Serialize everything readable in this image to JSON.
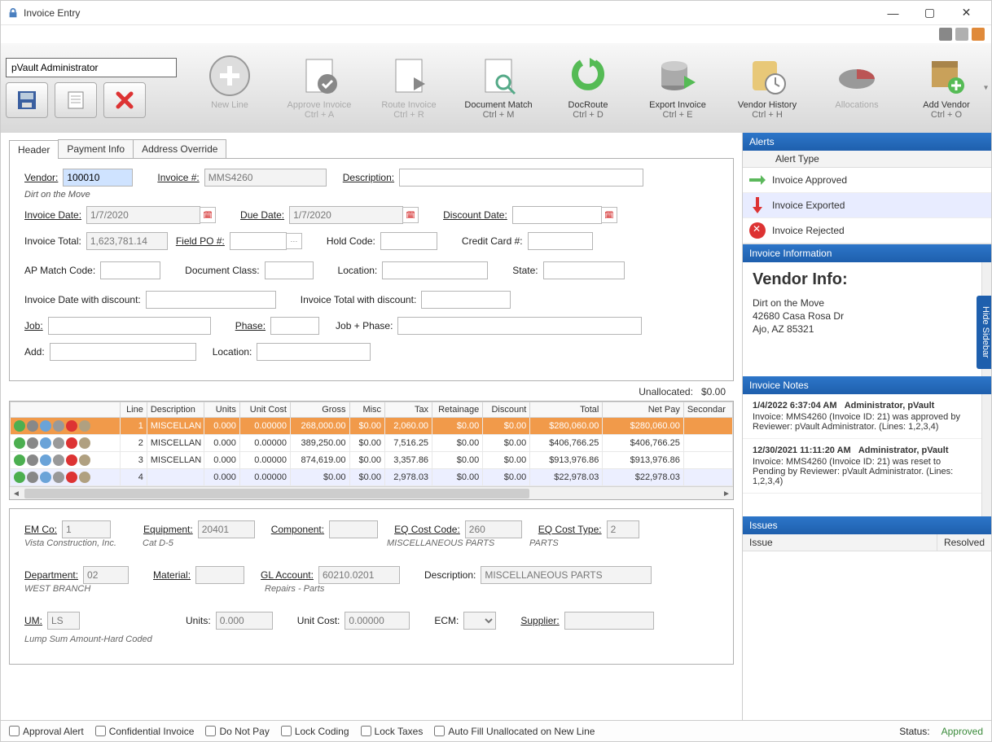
{
  "window": {
    "title": "Invoice Entry"
  },
  "user": "pVault Administrator",
  "toolbar": [
    {
      "label": "New Line",
      "shortcut": "",
      "disabled": true,
      "icon": "plus"
    },
    {
      "label": "Approve Invoice",
      "shortcut": "Ctrl + A",
      "disabled": true,
      "icon": "approve"
    },
    {
      "label": "Route Invoice",
      "shortcut": "Ctrl + R",
      "disabled": true,
      "icon": "route"
    },
    {
      "label": "Document Match",
      "shortcut": "Ctrl + M",
      "disabled": false,
      "icon": "docmatch"
    },
    {
      "label": "DocRoute",
      "shortcut": "Ctrl + D",
      "disabled": false,
      "icon": "docroute"
    },
    {
      "label": "Export Invoice",
      "shortcut": "Ctrl + E",
      "disabled": false,
      "icon": "export"
    },
    {
      "label": "Vendor History",
      "shortcut": "Ctrl + H",
      "disabled": false,
      "icon": "history"
    },
    {
      "label": "Allocations",
      "shortcut": "",
      "disabled": true,
      "icon": "alloc"
    },
    {
      "label": "Add Vendor",
      "shortcut": "Ctrl + O",
      "disabled": false,
      "icon": "addvendor"
    }
  ],
  "tabs": [
    "Header",
    "Payment Info",
    "Address Override"
  ],
  "header": {
    "vendor_label": "Vendor:",
    "vendor": "100010",
    "vendor_name": "Dirt on the Move",
    "invoice_no_label": "Invoice #:",
    "invoice_no": "MMS4260",
    "description_label": "Description:",
    "description": "",
    "invoice_date_label": "Invoice Date:",
    "invoice_date": "1/7/2020",
    "due_date_label": "Due Date:",
    "due_date": "1/7/2020",
    "discount_date_label": "Discount Date:",
    "discount_date": "",
    "invoice_total_label": "Invoice Total:",
    "invoice_total": "1,623,781.14",
    "field_po_label": "Field PO #:",
    "field_po": "",
    "hold_code_label": "Hold Code:",
    "hold_code": "",
    "credit_card_label": "Credit Card #:",
    "credit_card": "",
    "ap_match_label": "AP Match Code:",
    "ap_match": "",
    "doc_class_label": "Document Class:",
    "doc_class": "",
    "location_label": "Location:",
    "location": "",
    "state_label": "State:",
    "state": "",
    "inv_date_disc_label": "Invoice Date with discount:",
    "inv_date_disc": "",
    "inv_total_disc_label": "Invoice Total with discount:",
    "inv_total_disc": "",
    "job_label": "Job:",
    "job": "",
    "phase_label": "Phase:",
    "phase": "",
    "job_phase_label": "Job + Phase:",
    "job_phase": "",
    "add_label": "Add:",
    "add": "",
    "location2_label": "Location:",
    "location2": ""
  },
  "unallocated_label": "Unallocated:",
  "unallocated": "$0.00",
  "grid": {
    "columns": [
      "",
      "Line",
      "Description",
      "Units",
      "Unit Cost",
      "Gross",
      "Misc",
      "Tax",
      "Retainage",
      "Discount",
      "Total",
      "Net Pay",
      "Secondar"
    ],
    "rows": [
      {
        "line": "1",
        "desc": "MISCELLAN",
        "units": "0.000",
        "unitcost": "0.00000",
        "gross": "268,000.00",
        "misc": "$0.00",
        "tax": "2,060.00",
        "retainage": "$0.00",
        "discount": "$0.00",
        "total": "$280,060.00",
        "netpay": "$280,060.00",
        "sel": true
      },
      {
        "line": "2",
        "desc": "MISCELLAN",
        "units": "0.000",
        "unitcost": "0.00000",
        "gross": "389,250.00",
        "misc": "$0.00",
        "tax": "7,516.25",
        "retainage": "$0.00",
        "discount": "$0.00",
        "total": "$406,766.25",
        "netpay": "$406,766.25"
      },
      {
        "line": "3",
        "desc": "MISCELLAN",
        "units": "0.000",
        "unitcost": "0.00000",
        "gross": "874,619.00",
        "misc": "$0.00",
        "tax": "3,357.86",
        "retainage": "$0.00",
        "discount": "$0.00",
        "total": "$913,976.86",
        "netpay": "$913,976.86"
      },
      {
        "line": "4",
        "desc": "",
        "units": "0.000",
        "unitcost": "0.00000",
        "gross": "$0.00",
        "misc": "$0.00",
        "tax": "2,978.03",
        "retainage": "$0.00",
        "discount": "$0.00",
        "total": "$22,978.03",
        "netpay": "$22,978.03",
        "alt": true
      }
    ]
  },
  "detail": {
    "emco_label": "EM Co:",
    "emco": "1",
    "emco_sub": "Vista Construction, Inc.",
    "equipment_label": "Equipment:",
    "equipment": "20401",
    "equipment_sub": "Cat D-5",
    "component_label": "Component:",
    "component": "",
    "eqcostcode_label": "EQ Cost Code:",
    "eqcostcode": "260",
    "eqcostcode_sub": "MISCELLANEOUS PARTS",
    "eqcosttype_label": "EQ Cost Type:",
    "eqcosttype": "2",
    "eqcosttype_sub": "PARTS",
    "department_label": "Department:",
    "department": "02",
    "department_sub": "WEST BRANCH",
    "material_label": "Material:",
    "material": "",
    "glaccount_label": "GL Account:",
    "glaccount": "60210.0201",
    "glaccount_sub": "Repairs - Parts",
    "desc_label": "Description:",
    "desc": "MISCELLANEOUS PARTS",
    "um_label": "UM:",
    "um": "LS",
    "um_sub": "Lump Sum Amount-Hard Coded",
    "units_label": "Units:",
    "units": "0.000",
    "unitcost_label": "Unit Cost:",
    "unitcost": "0.00000",
    "ecm_label": "ECM:",
    "ecm": "",
    "supplier_label": "Supplier:",
    "supplier": ""
  },
  "alerts": {
    "title": "Alerts",
    "col": "Alert Type",
    "rows": [
      {
        "text": "Invoice Approved",
        "icon": "approve"
      },
      {
        "text": "Invoice Exported",
        "icon": "export",
        "sel": true
      },
      {
        "text": "Invoice Rejected",
        "icon": "reject"
      }
    ]
  },
  "info": {
    "title": "Invoice Information",
    "heading": "Vendor Info:",
    "lines": [
      "Dirt on the Move",
      "42680 Casa Rosa Dr",
      "Ajo, AZ 85321"
    ]
  },
  "notes": {
    "title": "Invoice Notes",
    "items": [
      {
        "ts": "1/4/2022 6:37:04 AM",
        "who": "Administrator, pVault",
        "body": "Invoice: MMS4260 (Invoice ID: 21) was approved by Reviewer: pVault Administrator. (Lines: 1,2,3,4)"
      },
      {
        "ts": "12/30/2021 11:11:20 AM",
        "who": "Administrator, pVault",
        "body": "Invoice: MMS4260 (Invoice ID: 21) was reset to Pending by Reviewer: pVault Administrator. (Lines: 1,2,3,4)"
      }
    ]
  },
  "issues": {
    "title": "Issues",
    "col1": "Issue",
    "col2": "Resolved"
  },
  "sidetab": "Hide Sidebar",
  "statusbar": {
    "checks": [
      "Approval Alert",
      "Confidential Invoice",
      "Do Not Pay",
      "Lock Coding",
      "Lock Taxes",
      "Auto Fill Unallocated on New Line"
    ],
    "status_label": "Status:",
    "status_value": "Approved"
  }
}
